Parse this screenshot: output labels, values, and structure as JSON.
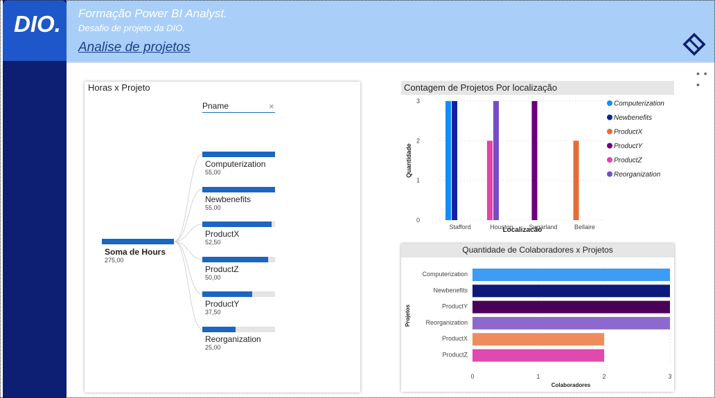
{
  "header": {
    "logo": "DIO.",
    "title": "Formação Power BI Analyst.",
    "subtitle": "Desafio de projeto da DIO.",
    "link": "Analise de projetos",
    "icon": "diamond-icon",
    "colors": {
      "header_bg": "#a9cff8",
      "sidebar_bg": "#0c1f73"
    }
  },
  "tree": {
    "title": "Horas x Projeto",
    "filter_label": "Pname",
    "filter_clear": "×",
    "root": {
      "label": "Soma de Hours",
      "value": "275,00"
    },
    "nodes": [
      {
        "label": "Computerization",
        "value": "55,00",
        "amount": 55
      },
      {
        "label": "Newbenefits",
        "value": "55,00",
        "amount": 55
      },
      {
        "label": "ProductX",
        "value": "52,50",
        "amount": 52.5
      },
      {
        "label": "ProductZ",
        "value": "50,00",
        "amount": 50
      },
      {
        "label": "ProductY",
        "value": "37,50",
        "amount": 37.5
      },
      {
        "label": "Reorganization",
        "value": "25,00",
        "amount": 25
      }
    ]
  },
  "chart_data": [
    {
      "type": "bar",
      "title": "Contagem de Projetos Por localização",
      "xlabel": "Localização",
      "ylabel": "Quantidade",
      "ylim": [
        0,
        3
      ],
      "yticks": [
        "0",
        "1",
        "2",
        "3"
      ],
      "categories": [
        "Stafford",
        "Houston",
        "Sugarland",
        "Bellaire"
      ],
      "legend_position": "right",
      "series": [
        {
          "name": "Computerization",
          "color": "#118dff",
          "values": [
            3,
            0,
            0,
            0
          ]
        },
        {
          "name": "Newbenefits",
          "color": "#12239e",
          "values": [
            3,
            0,
            0,
            0
          ]
        },
        {
          "name": "ProductX",
          "color": "#e66c37",
          "values": [
            0,
            0,
            0,
            2
          ]
        },
        {
          "name": "ProductY",
          "color": "#6b007b",
          "values": [
            0,
            0,
            3,
            0
          ]
        },
        {
          "name": "ProductZ",
          "color": "#e044a7",
          "values": [
            0,
            2,
            0,
            0
          ]
        },
        {
          "name": "Reorganization",
          "color": "#744ec2",
          "values": [
            0,
            3,
            0,
            0
          ]
        }
      ]
    },
    {
      "type": "bar",
      "orientation": "horizontal",
      "title": "Quantidade de Colaboradores x Projetos",
      "xlabel": "Colaboradores",
      "ylabel": "Projetos",
      "xlim": [
        0,
        3
      ],
      "xticks": [
        "0",
        "1",
        "2",
        "3"
      ],
      "categories": [
        "Computerization",
        "Newbenefits",
        "ProductY",
        "Reorganization",
        "ProductX",
        "ProductZ"
      ],
      "values": [
        3,
        3,
        3,
        3,
        2,
        2
      ],
      "colors": [
        "#3d9cf3",
        "#0b1a78",
        "#4b0057",
        "#8c6acd",
        "#ef8c5e",
        "#e049ad"
      ]
    }
  ],
  "menu": {
    "more": "• • •"
  }
}
